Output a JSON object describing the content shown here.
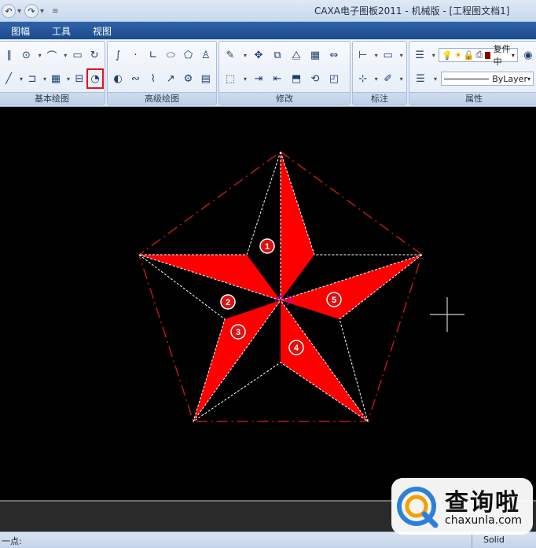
{
  "window": {
    "title": "CAXA电子图板2011 - 机械版 - [工程图文档1]"
  },
  "menu": {
    "items": [
      "图幅",
      "工具",
      "视图"
    ]
  },
  "ribbon": {
    "groups": {
      "basic_draw": "基本绘图",
      "advanced_draw": "高级绘图",
      "modify": "修改",
      "annotate": "标注",
      "properties": "属性"
    },
    "layer_combo": "复件中",
    "linetype_combo": "ByLayer",
    "highlighted_tool": "arc-ellipse-tool-icon"
  },
  "drawing": {
    "colors": {
      "star_fill": "#ff0000",
      "pentagon_line": "#b71a1a",
      "dashed_guides": "#ffffff",
      "center_marker": "#9b00ff"
    },
    "badges": [
      "1",
      "2",
      "3",
      "4",
      "5"
    ]
  },
  "status": {
    "left_text": "一点:",
    "linestyle": "Solid"
  },
  "watermark": {
    "chinese": "查询啦",
    "url": "chaxunla.com"
  }
}
